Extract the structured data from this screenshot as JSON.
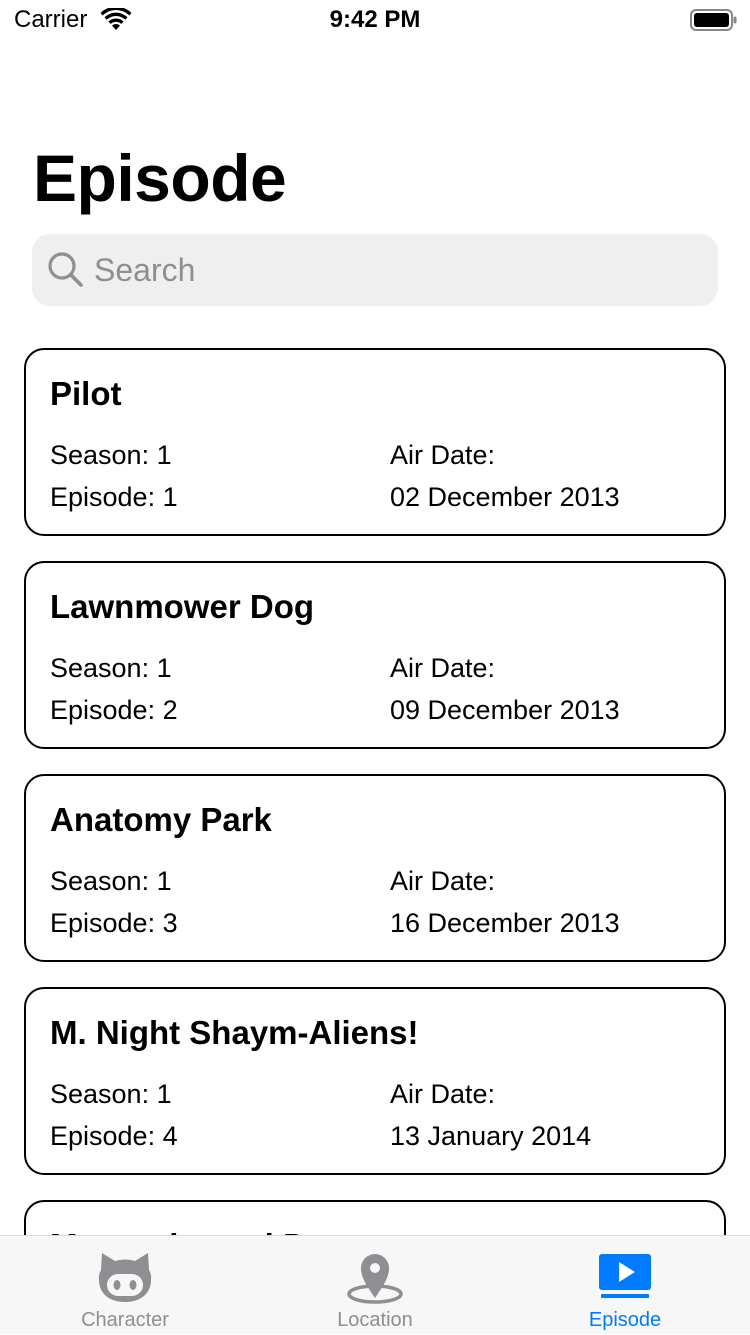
{
  "status_bar": {
    "carrier": "Carrier",
    "time": "9:42 PM"
  },
  "page": {
    "title": "Episode"
  },
  "search": {
    "placeholder": "Search",
    "value": ""
  },
  "episodes": [
    {
      "title": "Pilot",
      "season_text": "Season: 1",
      "episode_text": "Episode: 1",
      "air_date_label": "Air Date:",
      "air_date": "02 December 2013"
    },
    {
      "title": "Lawnmower Dog",
      "season_text": "Season: 1",
      "episode_text": "Episode: 2",
      "air_date_label": "Air Date:",
      "air_date": "09 December 2013"
    },
    {
      "title": "Anatomy Park",
      "season_text": "Season: 1",
      "episode_text": "Episode: 3",
      "air_date_label": "Air Date:",
      "air_date": "16 December 2013"
    },
    {
      "title": "M. Night Shaym-Aliens!",
      "season_text": "Season: 1",
      "episode_text": "Episode: 4",
      "air_date_label": "Air Date:",
      "air_date": "13 January 2014"
    },
    {
      "title": "Meeseeks and Destroy",
      "season_text": "",
      "episode_text": "",
      "air_date_label": "",
      "air_date": ""
    }
  ],
  "tab_bar": {
    "tabs": [
      {
        "label": "Character",
        "icon": "github-octocat-icon",
        "active": false
      },
      {
        "label": "Location",
        "icon": "map-pin-icon",
        "active": false
      },
      {
        "label": "Episode",
        "icon": "play-screen-icon",
        "active": true
      }
    ],
    "active_color": "#007aff",
    "inactive_color": "#8e8e93"
  }
}
